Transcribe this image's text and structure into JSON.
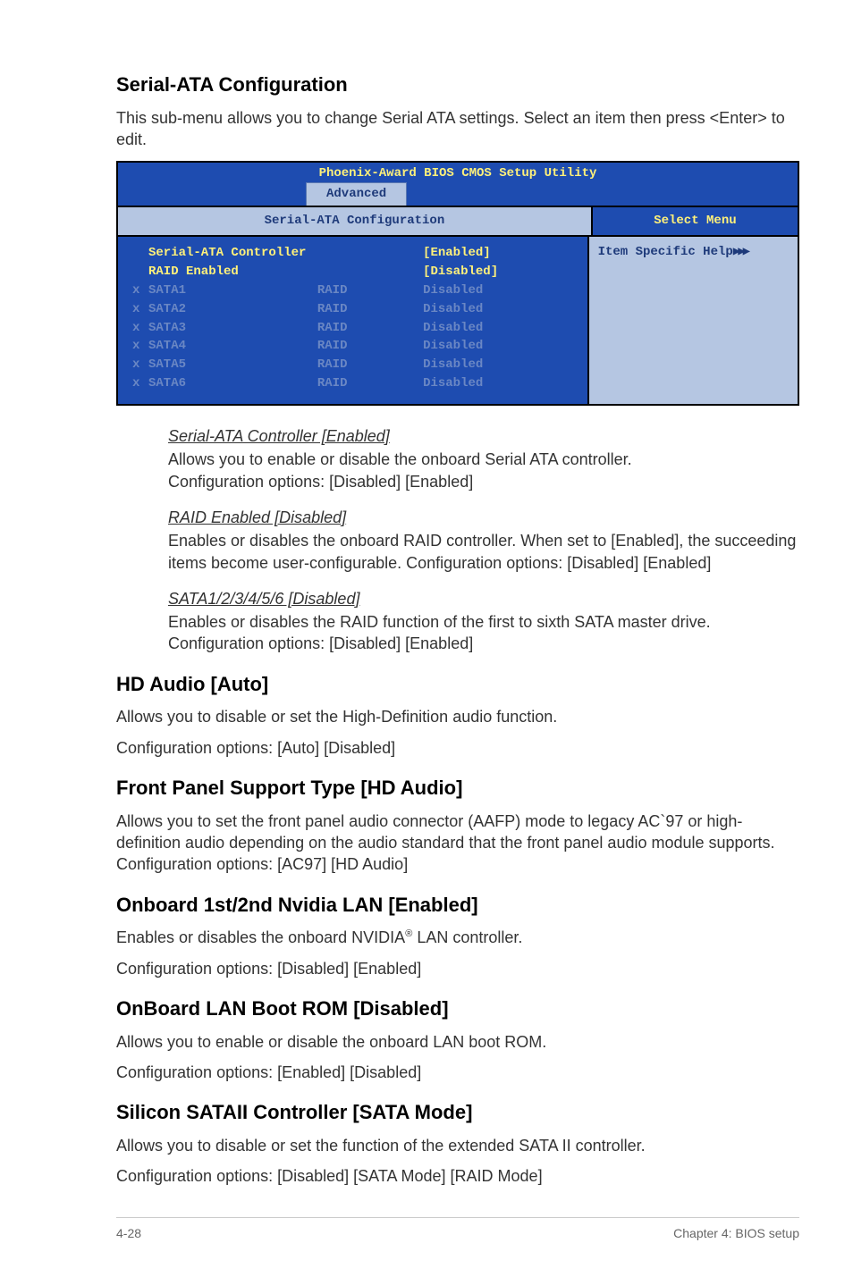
{
  "sections": {
    "serialAtaConfig": {
      "heading": "Serial-ATA Configuration",
      "intro": "This sub-menu allows you to change Serial ATA settings. Select an item then press <Enter> to edit."
    },
    "hdAudio": {
      "heading": "HD Audio [Auto]",
      "body1": "Allows you to disable or set the High-Definition audio function.",
      "body2": "Configuration options: [Auto] [Disabled]"
    },
    "frontPanel": {
      "heading": "Front Panel Support Type [HD Audio]",
      "body": "Allows you to set the front panel audio connector (AAFP) mode to legacy AC`97 or high-definition audio depending on the audio standard that the front panel audio module supports. Configuration options: [AC97] [HD Audio]"
    },
    "onboardLan": {
      "heading": "Onboard 1st/2nd Nvidia LAN [Enabled]",
      "body1_pre": "Enables or disables the onboard NVIDIA",
      "body1_post": " LAN controller.",
      "body2": "Configuration options: [Disabled] [Enabled]"
    },
    "lanBootRom": {
      "heading": "OnBoard LAN Boot ROM [Disabled]",
      "body1": "Allows you to enable or disable the onboard LAN boot ROM.",
      "body2": "Configuration options: [Enabled] [Disabled]"
    },
    "siliconSata": {
      "heading": "Silicon SATAII Controller [SATA Mode]",
      "body1": "Allows you to disable or set the function of the extended SATA II controller.",
      "body2": "Configuration options: [Disabled] [SATA Mode] [RAID Mode]"
    }
  },
  "bios": {
    "title": "Phoenix-Award BIOS CMOS Setup Utility",
    "tab": "Advanced",
    "configHeading": "Serial-ATA Configuration",
    "selectMenu": "Select Menu",
    "helpLabel": "Item Specific Help",
    "rows": [
      {
        "prefix": " ",
        "col1": "Serial-ATA Controller",
        "col2": "",
        "col3": "[Enabled]",
        "dim": false
      },
      {
        "prefix": " ",
        "col1": "RAID Enabled",
        "col2": "",
        "col3": "[Disabled]",
        "dim": false
      },
      {
        "prefix": "x",
        "col1": "SATA1",
        "col2": "RAID",
        "col3": "Disabled",
        "dim": true
      },
      {
        "prefix": "x",
        "col1": "SATA2",
        "col2": "RAID",
        "col3": "Disabled",
        "dim": true
      },
      {
        "prefix": "x",
        "col1": "SATA3",
        "col2": "RAID",
        "col3": "Disabled",
        "dim": true
      },
      {
        "prefix": "x",
        "col1": "SATA4",
        "col2": "RAID",
        "col3": "Disabled",
        "dim": true
      },
      {
        "prefix": "x",
        "col1": "SATA5",
        "col2": "RAID",
        "col3": "Disabled",
        "dim": true
      },
      {
        "prefix": "x",
        "col1": "SATA6",
        "col2": "RAID",
        "col3": "Disabled",
        "dim": true
      }
    ]
  },
  "subitems": {
    "item1": {
      "title": "Serial-ATA Controller [Enabled]",
      "line1": "Allows you to enable or disable the onboard Serial ATA controller.",
      "line2": "Configuration options: [Disabled] [Enabled]"
    },
    "item2": {
      "title": "RAID Enabled [Disabled]",
      "line1": "Enables or disables the onboard RAID controller. When set to [Enabled], the succeeding items become user-configurable. Configuration options: [Disabled] [Enabled]"
    },
    "item3": {
      "title": "SATA1/2/3/4/5/6 [Disabled]",
      "line1": "Enables or disables the RAID function of the first to sixth SATA master drive.",
      "line2": "Configuration options: [Disabled] [Enabled]"
    }
  },
  "footer": {
    "left": "4-28",
    "right": "Chapter 4: BIOS setup"
  }
}
